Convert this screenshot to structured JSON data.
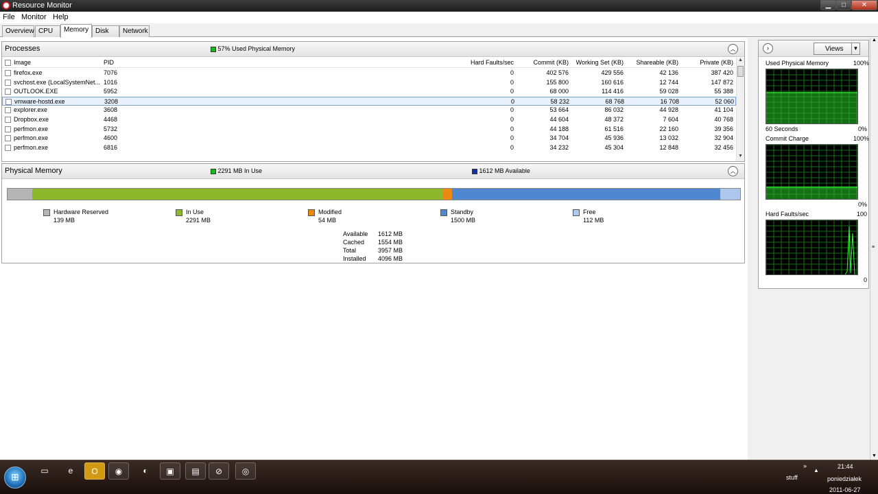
{
  "window": {
    "title": "Resource Monitor",
    "min": "▁",
    "max": "□",
    "close": "✕"
  },
  "menu": [
    "File",
    "Monitor",
    "Help"
  ],
  "tabs": [
    {
      "label": "Overview",
      "active": false
    },
    {
      "label": "CPU",
      "active": false
    },
    {
      "label": "Memory",
      "active": true
    },
    {
      "label": "Disk",
      "active": false
    },
    {
      "label": "Network",
      "active": false
    }
  ],
  "processes": {
    "title": "Processes",
    "legend": "57% Used Physical Memory",
    "legend_color": "#10c010",
    "columns": [
      "Image",
      "PID",
      "Hard Faults/sec",
      "Commit (KB)",
      "Working Set (KB)",
      "Shareable (KB)",
      "Private (KB)"
    ],
    "rows": [
      {
        "image": "firefox.exe",
        "pid": "7076",
        "faults": "0",
        "commit": "402 576",
        "ws": "429 556",
        "share": "42 136",
        "priv": "387 420"
      },
      {
        "image": "svchost.exe (LocalSystemNet...",
        "pid": "1016",
        "faults": "0",
        "commit": "155 800",
        "ws": "160 616",
        "share": "12 744",
        "priv": "147 872"
      },
      {
        "image": "OUTLOOK.EXE",
        "pid": "5952",
        "faults": "0",
        "commit": "68 000",
        "ws": "114 416",
        "share": "59 028",
        "priv": "55 388"
      },
      {
        "image": "vmware-hostd.exe",
        "pid": "3208",
        "faults": "0",
        "commit": "58 232",
        "ws": "68 768",
        "share": "16 708",
        "priv": "52 060"
      },
      {
        "image": "explorer.exe",
        "pid": "3608",
        "faults": "0",
        "commit": "53 664",
        "ws": "86 032",
        "share": "44 928",
        "priv": "41 104"
      },
      {
        "image": "Dropbox.exe",
        "pid": "4468",
        "faults": "0",
        "commit": "44 604",
        "ws": "48 372",
        "share": "7 604",
        "priv": "40 768"
      },
      {
        "image": "perfmon.exe",
        "pid": "5732",
        "faults": "0",
        "commit": "44 188",
        "ws": "61 516",
        "share": "22 160",
        "priv": "39 356"
      },
      {
        "image": "perfmon.exe",
        "pid": "4600",
        "faults": "0",
        "commit": "34 704",
        "ws": "45 936",
        "share": "13 032",
        "priv": "32 904"
      },
      {
        "image": "perfmon.exe",
        "pid": "6816",
        "faults": "0",
        "commit": "34 232",
        "ws": "45 304",
        "share": "12 848",
        "priv": "32 456"
      }
    ],
    "selected_index": 3
  },
  "physical": {
    "title": "Physical Memory",
    "in_use_legend": "2291 MB In Use",
    "available_legend": "1612 MB Available",
    "segments": [
      {
        "label": "Hardware Reserved",
        "value": "139 MB",
        "mb": 139,
        "color": "#b5b5b5"
      },
      {
        "label": "In Use",
        "value": "2291 MB",
        "mb": 2291,
        "color": "#8db82b"
      },
      {
        "label": "Modified",
        "value": "54 MB",
        "mb": 54,
        "color": "#ea8a14"
      },
      {
        "label": "Standby",
        "value": "1500 MB",
        "mb": 1500,
        "color": "#4f88cf"
      },
      {
        "label": "Free",
        "value": "112 MB",
        "mb": 112,
        "color": "#adc8ec"
      }
    ],
    "stats": [
      {
        "key": "Available",
        "value": "1612 MB"
      },
      {
        "key": "Cached",
        "value": "1554 MB"
      },
      {
        "key": "Total",
        "value": "3957 MB"
      },
      {
        "key": "Installed",
        "value": "4096 MB"
      }
    ]
  },
  "graphs": {
    "views_label": "Views",
    "items": [
      {
        "title": "Used Physical Memory",
        "top": "100%",
        "bottom_left": "60 Seconds",
        "bottom": "0%",
        "level": 0.57
      },
      {
        "title": "Commit Charge",
        "top": "100%",
        "bottom_left": "",
        "bottom": "0%",
        "level": 0.22
      },
      {
        "title": "Hard Faults/sec",
        "top": "100",
        "bottom_left": "",
        "bottom": "0",
        "level": 0.0
      }
    ]
  },
  "taskbar": {
    "tray_label": "stuff",
    "time": "21:44",
    "day": "poniedziałek",
    "date": "2011-06-27"
  }
}
